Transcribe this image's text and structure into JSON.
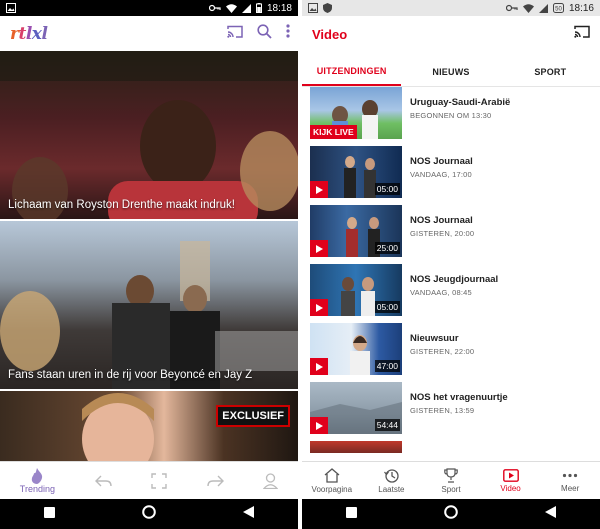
{
  "left": {
    "status": {
      "time": "18:18"
    },
    "app": {
      "logo": "rtlxl"
    },
    "feed": [
      {
        "caption": "Lichaam van Royston Drenthe  maakt indruk!"
      },
      {
        "caption": "Fans staan uren in de rij voor Beyoncé en Jay Z"
      },
      {
        "caption": "",
        "badge": "EXCLUSIEF"
      }
    ],
    "bottom_nav": {
      "trending_label": "Trending"
    },
    "colors": {
      "accent": "#7c63b5"
    }
  },
  "right": {
    "status": {
      "time": "18:16"
    },
    "app": {
      "title": "Video"
    },
    "tabs": [
      {
        "label": "UITZENDINGEN",
        "active": true
      },
      {
        "label": "NIEUWS",
        "active": false
      },
      {
        "label": "SPORT",
        "active": false
      }
    ],
    "videos": [
      {
        "title": "Uruguay-Saudi-Arabië",
        "subtitle": "BEGONNEN OM 13:30",
        "live": "KIJK LIVE",
        "duration": ""
      },
      {
        "title": "NOS Journaal",
        "subtitle": "VANDAAG, 17:00",
        "live": "",
        "duration": "05:00"
      },
      {
        "title": "NOS Journaal",
        "subtitle": "GISTEREN, 20:00",
        "live": "",
        "duration": "25:00"
      },
      {
        "title": "NOS Jeugdjournaal",
        "subtitle": "VANDAAG, 08:45",
        "live": "",
        "duration": "05:00"
      },
      {
        "title": "Nieuwsuur",
        "subtitle": "GISTEREN, 22:00",
        "live": "",
        "duration": "47:00"
      },
      {
        "title": "NOS het vragenuurtje",
        "subtitle": "GISTEREN, 13:59",
        "live": "",
        "duration": "54:44"
      }
    ],
    "bottom_nav": [
      {
        "label": "Voorpagina",
        "icon": "home-icon"
      },
      {
        "label": "Laatste",
        "icon": "history-icon"
      },
      {
        "label": "Sport",
        "icon": "trophy-icon"
      },
      {
        "label": "Video",
        "icon": "video-icon",
        "active": true
      },
      {
        "label": "Meer",
        "icon": "more-icon"
      }
    ],
    "colors": {
      "accent": "#e0001b"
    }
  }
}
